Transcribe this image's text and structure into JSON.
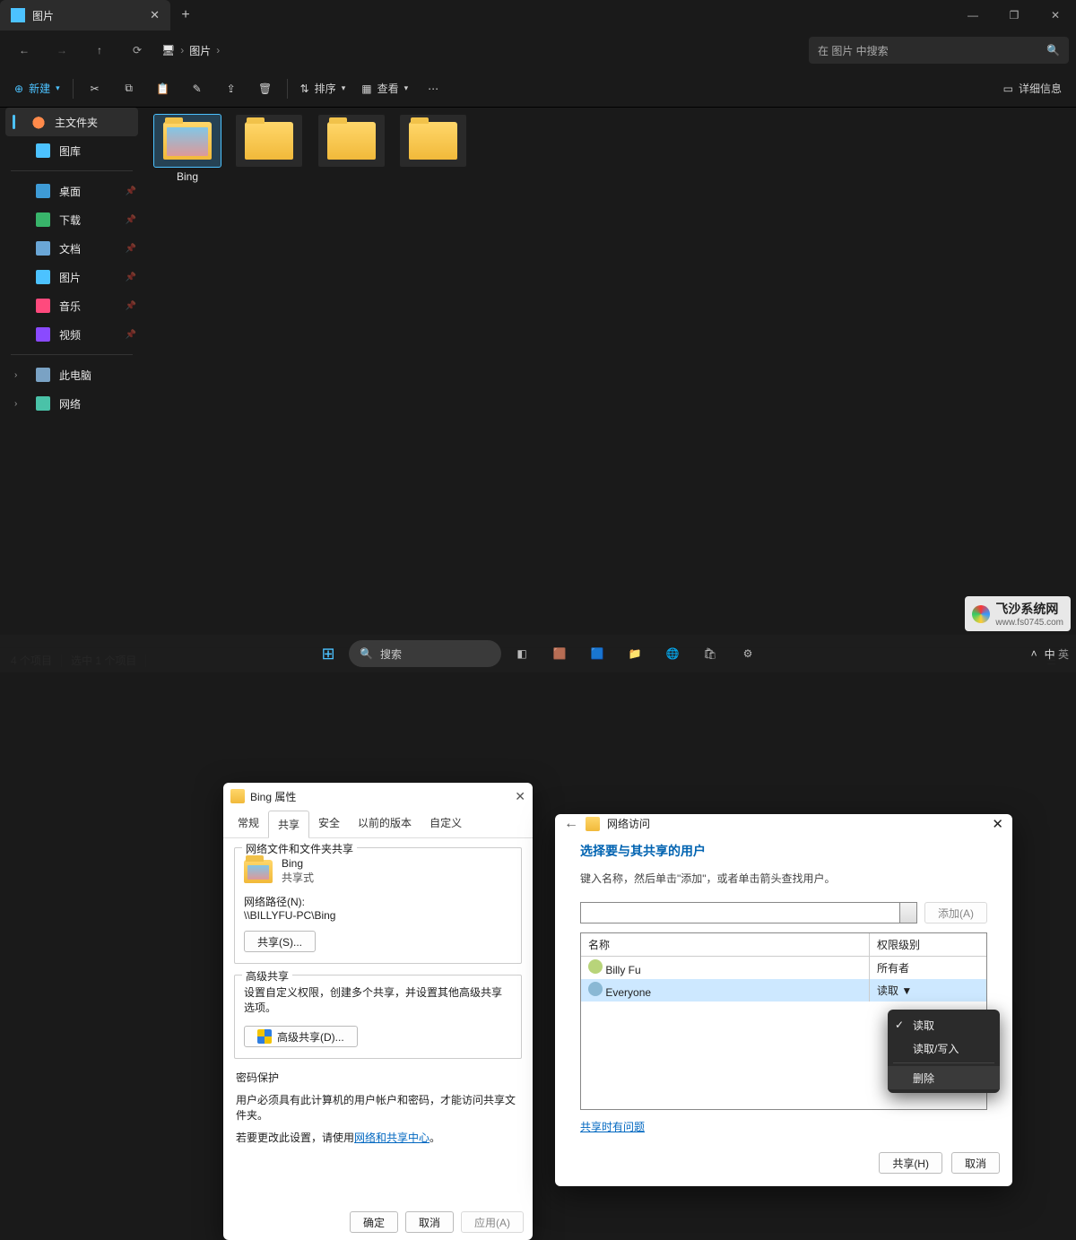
{
  "window": {
    "tab_title": "图片",
    "minimize": "—",
    "maximize": "❐",
    "close": "✕",
    "new_tab": "+"
  },
  "nav": {
    "back": "←",
    "forward": "→",
    "up": "↑",
    "refresh": "⟳"
  },
  "breadcrumb": {
    "icon": "🖥",
    "seg1": "图片"
  },
  "search": {
    "placeholder": "在 图片 中搜索"
  },
  "toolbar": {
    "new": "新建",
    "cut": "✂",
    "copy": "⧉",
    "paste": "□",
    "rename": "✎",
    "share": "↗",
    "delete": "🗑",
    "sort": "排序",
    "view": "查看",
    "more": "⋯",
    "details": "详细信息"
  },
  "sidebar": {
    "home": "主文件夹",
    "gallery": "图库",
    "desktop": "桌面",
    "downloads": "下载",
    "documents": "文档",
    "pictures": "图片",
    "music": "音乐",
    "videos": "视频",
    "this_pc": "此电脑",
    "network": "网络"
  },
  "folders": {
    "f0": "Bing"
  },
  "status": {
    "count": "4 个项目",
    "selected": "选中 1 个项目"
  },
  "props": {
    "title": "Bing 属性",
    "tabs": {
      "general": "常规",
      "share": "共享",
      "security": "安全",
      "previous": "以前的版本",
      "custom": "自定义"
    },
    "g1_legend": "网络文件和文件夹共享",
    "name": "Bing",
    "state": "共享式",
    "path_label": "网络路径(N):",
    "path": "\\\\BILLYFU-PC\\Bing",
    "share_btn": "共享(S)...",
    "g2_legend": "高级共享",
    "g2_text": "设置自定义权限，创建多个共享，并设置其他高级共享选项。",
    "adv_btn": "高级共享(D)...",
    "g3_legend": "密码保护",
    "g3_l1": "用户必须具有此计算机的用户帐户和密码，才能访问共享文件夹。",
    "g3_l2a": "若要更改此设置，请使用",
    "g3_link": "网络和共享中心",
    "g3_l2b": "。",
    "ok": "确定",
    "cancel": "取消",
    "apply": "应用(A)"
  },
  "netdlg": {
    "crumb": "网络访问",
    "h2": "选择要与其共享的用户",
    "hint": "键入名称，然后单击\"添加\"，或者单击箭头查找用户。",
    "add_btn": "添加(A)",
    "col_name": "名称",
    "col_perm": "权限级别",
    "rows": [
      {
        "name": "Billy Fu",
        "perm": "所有者"
      },
      {
        "name": "Everyone",
        "perm": "读取 ▼"
      }
    ],
    "trouble": "共享时有问题",
    "share": "共享(H)",
    "cancel": "取消"
  },
  "ctxmenu": {
    "read": "读取",
    "readwrite": "读取/写入",
    "remove": "删除"
  },
  "taskbar": {
    "search": "搜索",
    "lang1": "中",
    "lang2": "英"
  },
  "watermark": {
    "name": "飞沙系统网",
    "url": "www.fs0745.com"
  }
}
